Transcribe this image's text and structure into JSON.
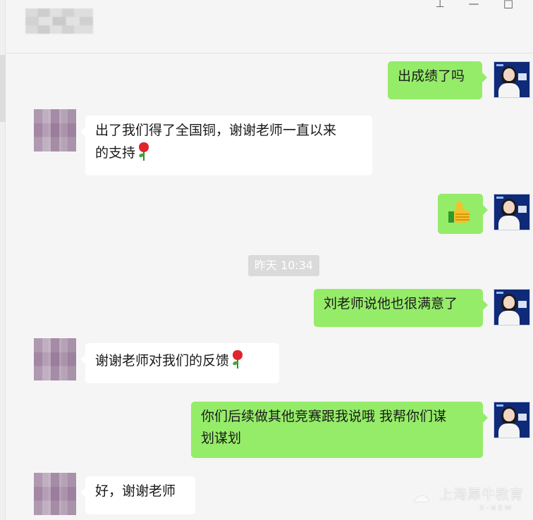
{
  "window": {
    "title_blurred": "",
    "controls": {
      "pin_icon": "pin-icon",
      "minimize_icon": "minimize-icon",
      "maximize_icon": "maximize-icon"
    }
  },
  "chat": {
    "messages": [
      {
        "side": "out",
        "text": "出成绩了吗"
      },
      {
        "side": "in",
        "text_line1": "出了我们得了全国铜，谢谢老师一直以来",
        "text_line2": "的支持",
        "emoji": "rose-icon"
      },
      {
        "side": "out",
        "emoji": "thumbs-up-icon"
      },
      {
        "timestamp": "昨天 10:34"
      },
      {
        "side": "out",
        "text": "刘老师说他也很满意了"
      },
      {
        "side": "in",
        "text": "谢谢老师对我们的反馈",
        "emoji": "rose-icon"
      },
      {
        "side": "out",
        "text_line1": "你们后续做其他竞赛跟我说哦 我帮你们谋",
        "text_line2": "划谋划"
      },
      {
        "side": "in",
        "text": "好，谢谢老师"
      }
    ]
  },
  "watermark": {
    "icon": "wechat-icon",
    "text": "上海犀牛教育",
    "sub": "X-NEW"
  },
  "colors": {
    "outgoing_bubble": "#95ec69",
    "incoming_bubble": "#ffffff",
    "background": "#f5f5f5",
    "timestamp_bg": "#dadada"
  }
}
